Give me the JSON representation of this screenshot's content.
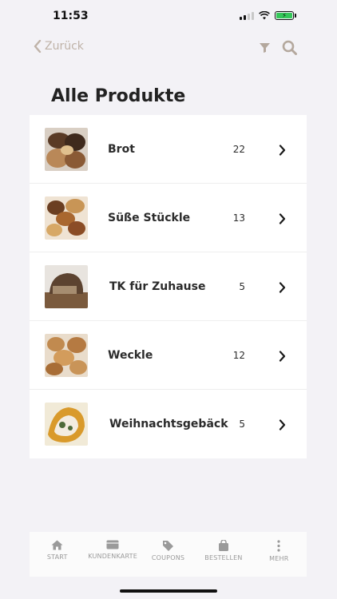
{
  "status": {
    "time": "11:53"
  },
  "nav": {
    "back_label": "Zurück"
  },
  "page_title": "Alle Produkte",
  "categories": [
    {
      "name": "Brot",
      "count": "22"
    },
    {
      "name": "Süße Stückle",
      "count": "13"
    },
    {
      "name": "TK für Zuhause",
      "count": "5"
    },
    {
      "name": "Weckle",
      "count": "12"
    },
    {
      "name": "Weihnachtsgebäck",
      "count": "5"
    }
  ],
  "tabs": [
    {
      "label": "START",
      "icon": "home-icon"
    },
    {
      "label": "KUNDENKARTE",
      "icon": "card-icon"
    },
    {
      "label": "COUPONS",
      "icon": "tag-icon"
    },
    {
      "label": "BESTELLEN",
      "icon": "bag-icon"
    },
    {
      "label": "MEHR",
      "icon": "more-icon"
    }
  ],
  "colors": {
    "accent": "#bfb3a8",
    "background": "#f3f2f6",
    "battery": "#34c759"
  }
}
